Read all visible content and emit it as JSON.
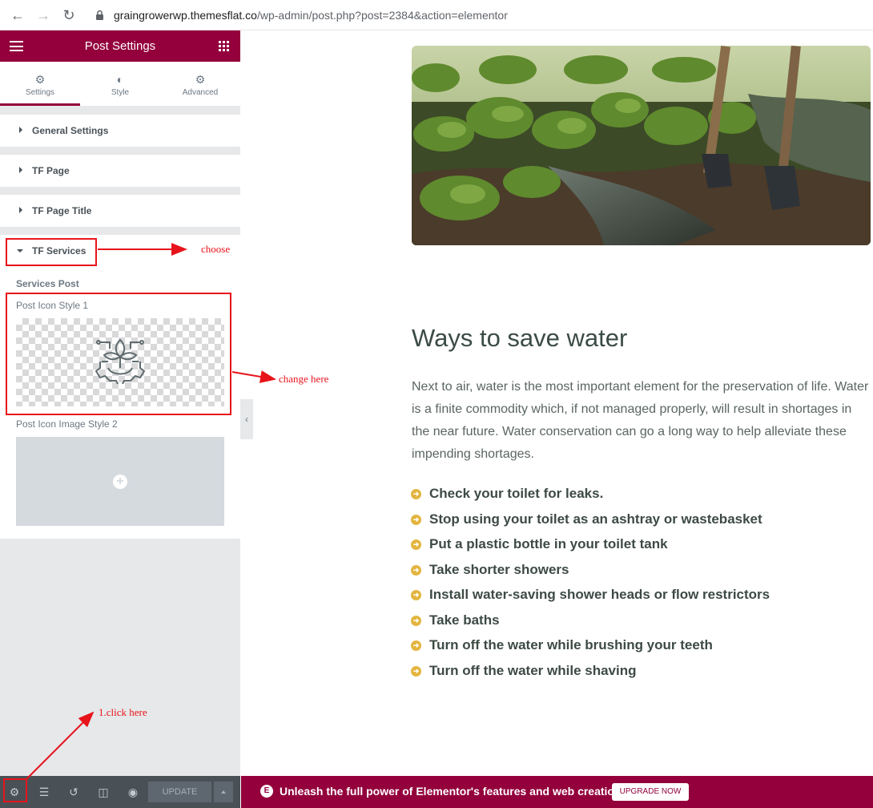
{
  "browser": {
    "url_host": "graingrowerwp.themesflat.co",
    "url_path": "/wp-admin/post.php?post=2384&action=elementor"
  },
  "panel": {
    "title": "Post Settings",
    "tabs": [
      {
        "label": "Settings",
        "icon": "gear-icon",
        "active": true
      },
      {
        "label": "Style",
        "icon": "half-circle-icon",
        "active": false
      },
      {
        "label": "Advanced",
        "icon": "gear-icon",
        "active": false
      }
    ],
    "sections": [
      {
        "label": "General Settings",
        "expanded": false
      },
      {
        "label": "TF Page",
        "expanded": false
      },
      {
        "label": "TF Page Title",
        "expanded": false
      },
      {
        "label": "TF Services",
        "expanded": true
      }
    ],
    "services": {
      "heading": "Services Post",
      "icon_style_1_label": "Post Icon Style 1",
      "icon_style_2_label": "Post Icon Image Style 2"
    },
    "footer": {
      "update_label": "UPDATE"
    }
  },
  "annotations": {
    "choose": "choose",
    "change_here": "change here",
    "click_here": "1.click here",
    "color": "#e8141b"
  },
  "content": {
    "heading": "Ways to save water",
    "intro": "Next to air, water is the most important element for the preservation of life. Water is a finite commodity which, if not managed properly, will result in shortages in the near future. Water conservation can go a long way to help alleviate these impending shortages.",
    "tips": [
      "Check your toilet for leaks.",
      "Stop using your toilet as an ashtray or wastebasket",
      "Put a plastic bottle in your toilet tank",
      "Take shorter showers",
      "Install water-saving shower heads or flow restrictors",
      "Take baths",
      "Turn off the water while brushing your teeth",
      "Turn off the water while shaving"
    ]
  },
  "promo": {
    "message": "Unleash the full power of Elementor's features and web creation tools.",
    "button": "UPGRADE NOW"
  },
  "colors": {
    "brand": "#93003c",
    "bullet": "#e3b53f"
  }
}
